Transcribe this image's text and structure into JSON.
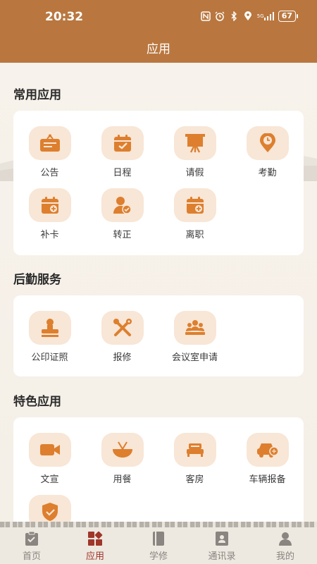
{
  "status": {
    "time": "20:32",
    "network": "5G",
    "battery": "67"
  },
  "header": {
    "title": "应用"
  },
  "sections": [
    {
      "title": "常用应用",
      "apps": [
        {
          "label": "公告",
          "icon": "notice-board-icon"
        },
        {
          "label": "日程",
          "icon": "calendar-check-icon"
        },
        {
          "label": "请假",
          "icon": "easel-board-icon"
        },
        {
          "label": "考勤",
          "icon": "location-clock-icon"
        },
        {
          "label": "补卡",
          "icon": "calendar-add-icon"
        },
        {
          "label": "转正",
          "icon": "user-check-icon"
        },
        {
          "label": "离职",
          "icon": "calendar-exit-icon"
        }
      ]
    },
    {
      "title": "后勤服务",
      "apps": [
        {
          "label": "公印证照",
          "icon": "seal-stamp-icon"
        },
        {
          "label": "报修",
          "icon": "tools-icon"
        },
        {
          "label": "会议室申请",
          "icon": "meeting-room-icon"
        }
      ]
    },
    {
      "title": "特色应用",
      "apps": [
        {
          "label": "文宣",
          "icon": "video-camera-icon"
        },
        {
          "label": "用餐",
          "icon": "bowl-icon"
        },
        {
          "label": "客房",
          "icon": "bed-icon"
        },
        {
          "label": "车辆报备",
          "icon": "car-report-icon"
        },
        {
          "label": "",
          "icon": "shield-check-icon"
        }
      ]
    }
  ],
  "tabbar": [
    {
      "label": "首页",
      "icon": "home-clipboard-icon",
      "active": false
    },
    {
      "label": "应用",
      "icon": "apps-grid-icon",
      "active": true
    },
    {
      "label": "学修",
      "icon": "book-icon",
      "active": false
    },
    {
      "label": "通讯录",
      "icon": "contacts-icon",
      "active": false
    },
    {
      "label": "我的",
      "icon": "user-icon",
      "active": false
    }
  ],
  "colors": {
    "header": "#b9773f",
    "accent_icon": "#dd7f2e",
    "icon_bg": "#f8e6d6",
    "tab_active": "#a0352a",
    "tab_inactive": "#8a8580"
  }
}
